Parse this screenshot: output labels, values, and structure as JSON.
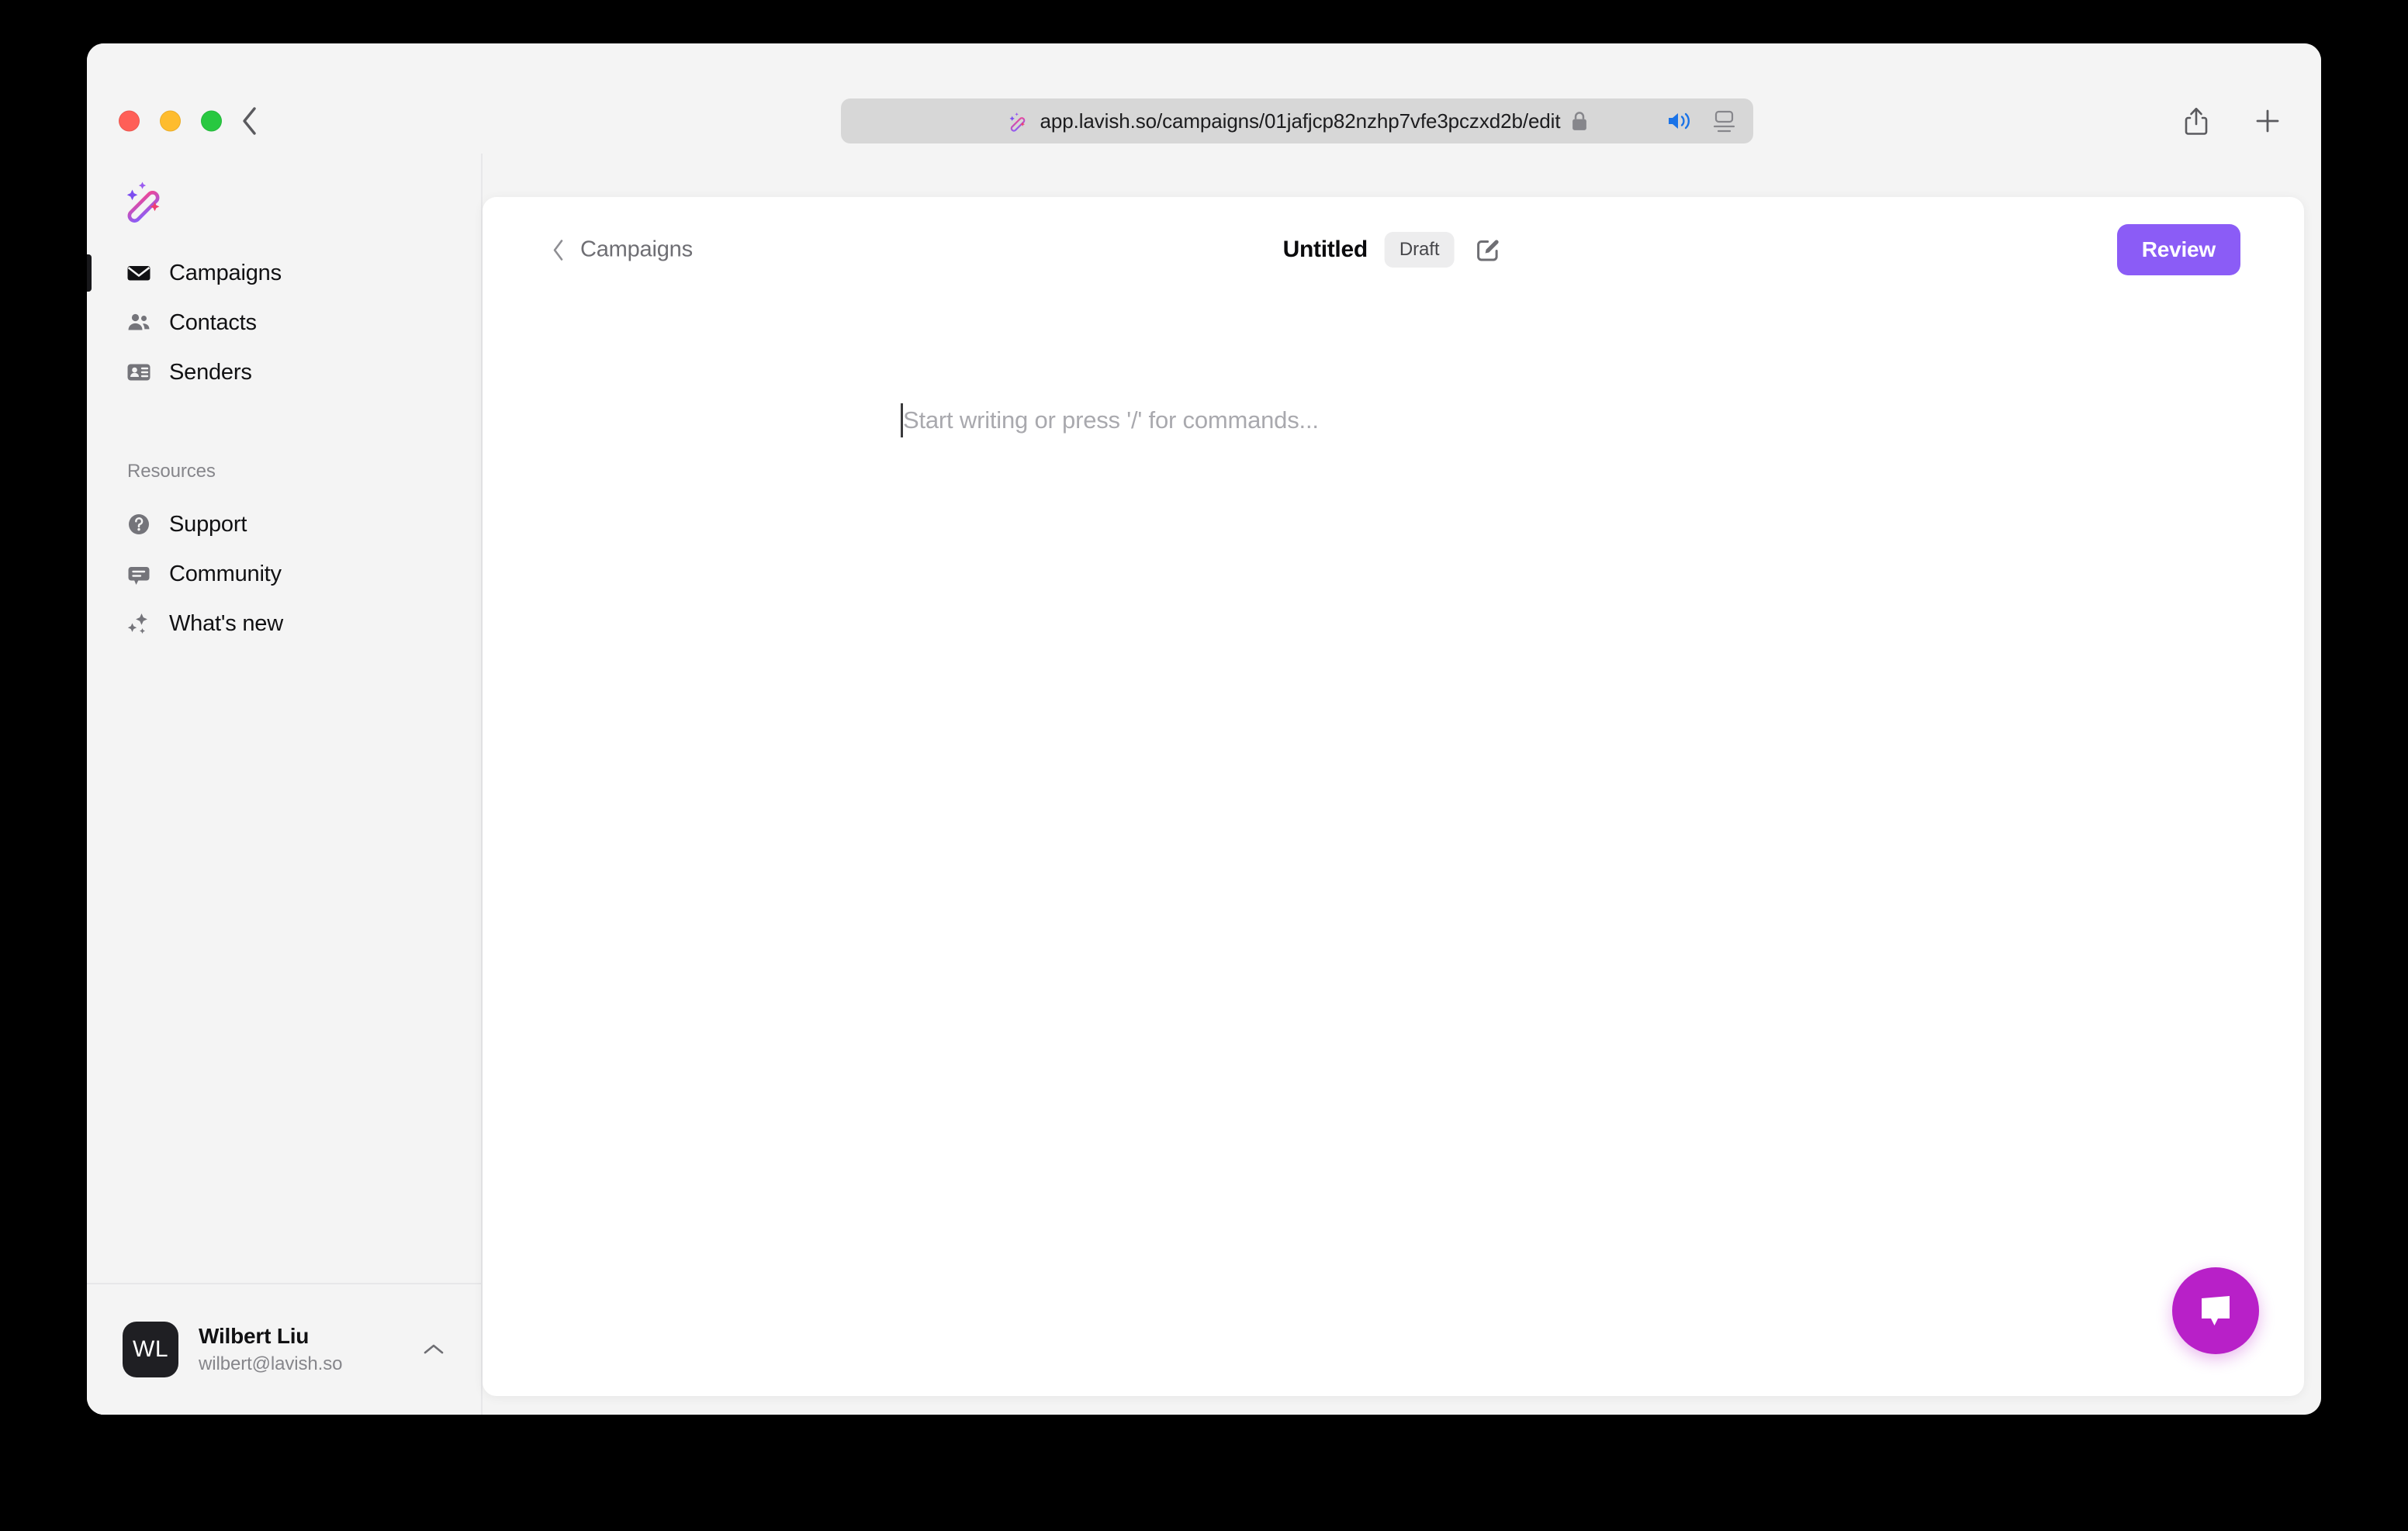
{
  "browser": {
    "traffic_lights": {
      "close": "close-window",
      "minimize": "minimize-window",
      "maximize": "maximize-window",
      "close_color": "#ff5f57",
      "minimize_color": "#febc2e",
      "maximize_color": "#28c840"
    },
    "back_icon": "chevron-left-icon",
    "address_bar": {
      "favicon": "magic-wand-favicon",
      "url": "app.lavish.so/campaigns/01jafjcp82nzhp7vfe3pczxd2b/edit",
      "lock_icon": "lock-icon",
      "audio_icon": "speaker-playing-icon",
      "audio_color": "#1a73e8",
      "reader_icon": "reader-view-icon"
    },
    "share_icon": "share-icon",
    "new_tab_icon": "plus-icon"
  },
  "sidebar": {
    "logo": "magic-wand-logo",
    "nav_items": [
      {
        "label": "Campaigns",
        "icon": "envelope-icon",
        "active": true
      },
      {
        "label": "Contacts",
        "icon": "people-icon",
        "active": false
      },
      {
        "label": "Senders",
        "icon": "contact-card-icon",
        "active": false
      }
    ],
    "resources_heading": "Resources",
    "resource_items": [
      {
        "label": "Support",
        "icon": "question-circle-icon"
      },
      {
        "label": "Community",
        "icon": "chat-bubble-icon"
      },
      {
        "label": "What's new",
        "icon": "sparkles-icon"
      }
    ],
    "user": {
      "initials": "WL",
      "name": "Wilbert Liu",
      "email": "wilbert@lavish.so",
      "chevron_icon": "chevron-up-icon"
    }
  },
  "main": {
    "breadcrumb": {
      "back_icon": "chevron-left-icon",
      "label": "Campaigns"
    },
    "title": "Untitled",
    "status_badge": "Draft",
    "edit_icon": "pencil-square-icon",
    "review_label": "Review",
    "review_color": "#8b5cf6",
    "editor": {
      "placeholder": "Start writing or press '/' for commands...",
      "value": ""
    },
    "chat_widget": {
      "icon": "chat-bubble-icon",
      "color": "#b820c8"
    }
  }
}
